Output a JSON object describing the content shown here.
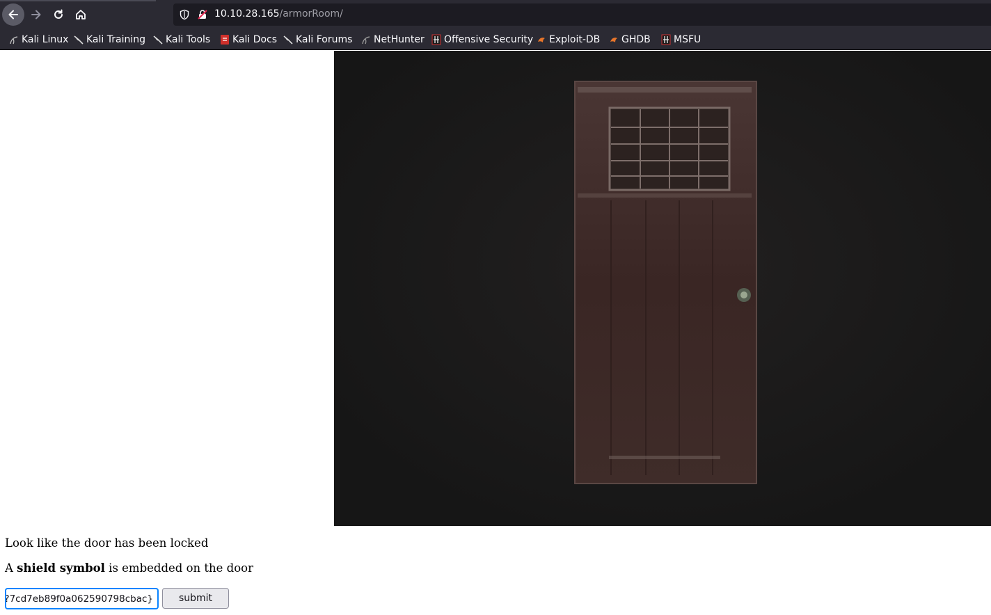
{
  "browser": {
    "url_host": "10.10.28.165",
    "url_path": "/armorRoom/"
  },
  "bookmarks": [
    {
      "label": "Kali Linux",
      "icon": "kali-dragon-icon"
    },
    {
      "label": "Kali Training",
      "icon": "kali-dragon-icon"
    },
    {
      "label": "Kali Tools",
      "icon": "kali-dragon-icon"
    },
    {
      "label": "Kali Docs",
      "icon": "kali-docs-icon"
    },
    {
      "label": "Kali Forums",
      "icon": "kali-dragon-icon"
    },
    {
      "label": "NetHunter",
      "icon": "nethunter-icon"
    },
    {
      "label": "Offensive Security",
      "icon": "offsec-icon"
    },
    {
      "label": "Exploit-DB",
      "icon": "exploitdb-icon"
    },
    {
      "label": "GHDB",
      "icon": "exploitdb-icon"
    },
    {
      "label": "MSFU",
      "icon": "offsec-icon"
    }
  ],
  "page": {
    "locked_message": "Look like the door has been locked",
    "shield_prefix": "A ",
    "shield_bold": "shield symbol",
    "shield_suffix": " is embedded on the door",
    "answer_value": "?7cd7eb89f0a062590798cbac}",
    "submit_label": "submit"
  },
  "colors": {
    "chrome_bg": "#2b2a33",
    "urlbar_bg": "#1c1b22",
    "focus_ring": "#0a84ff",
    "door_bg": "#1a1a1a",
    "door": "#3a2624"
  }
}
